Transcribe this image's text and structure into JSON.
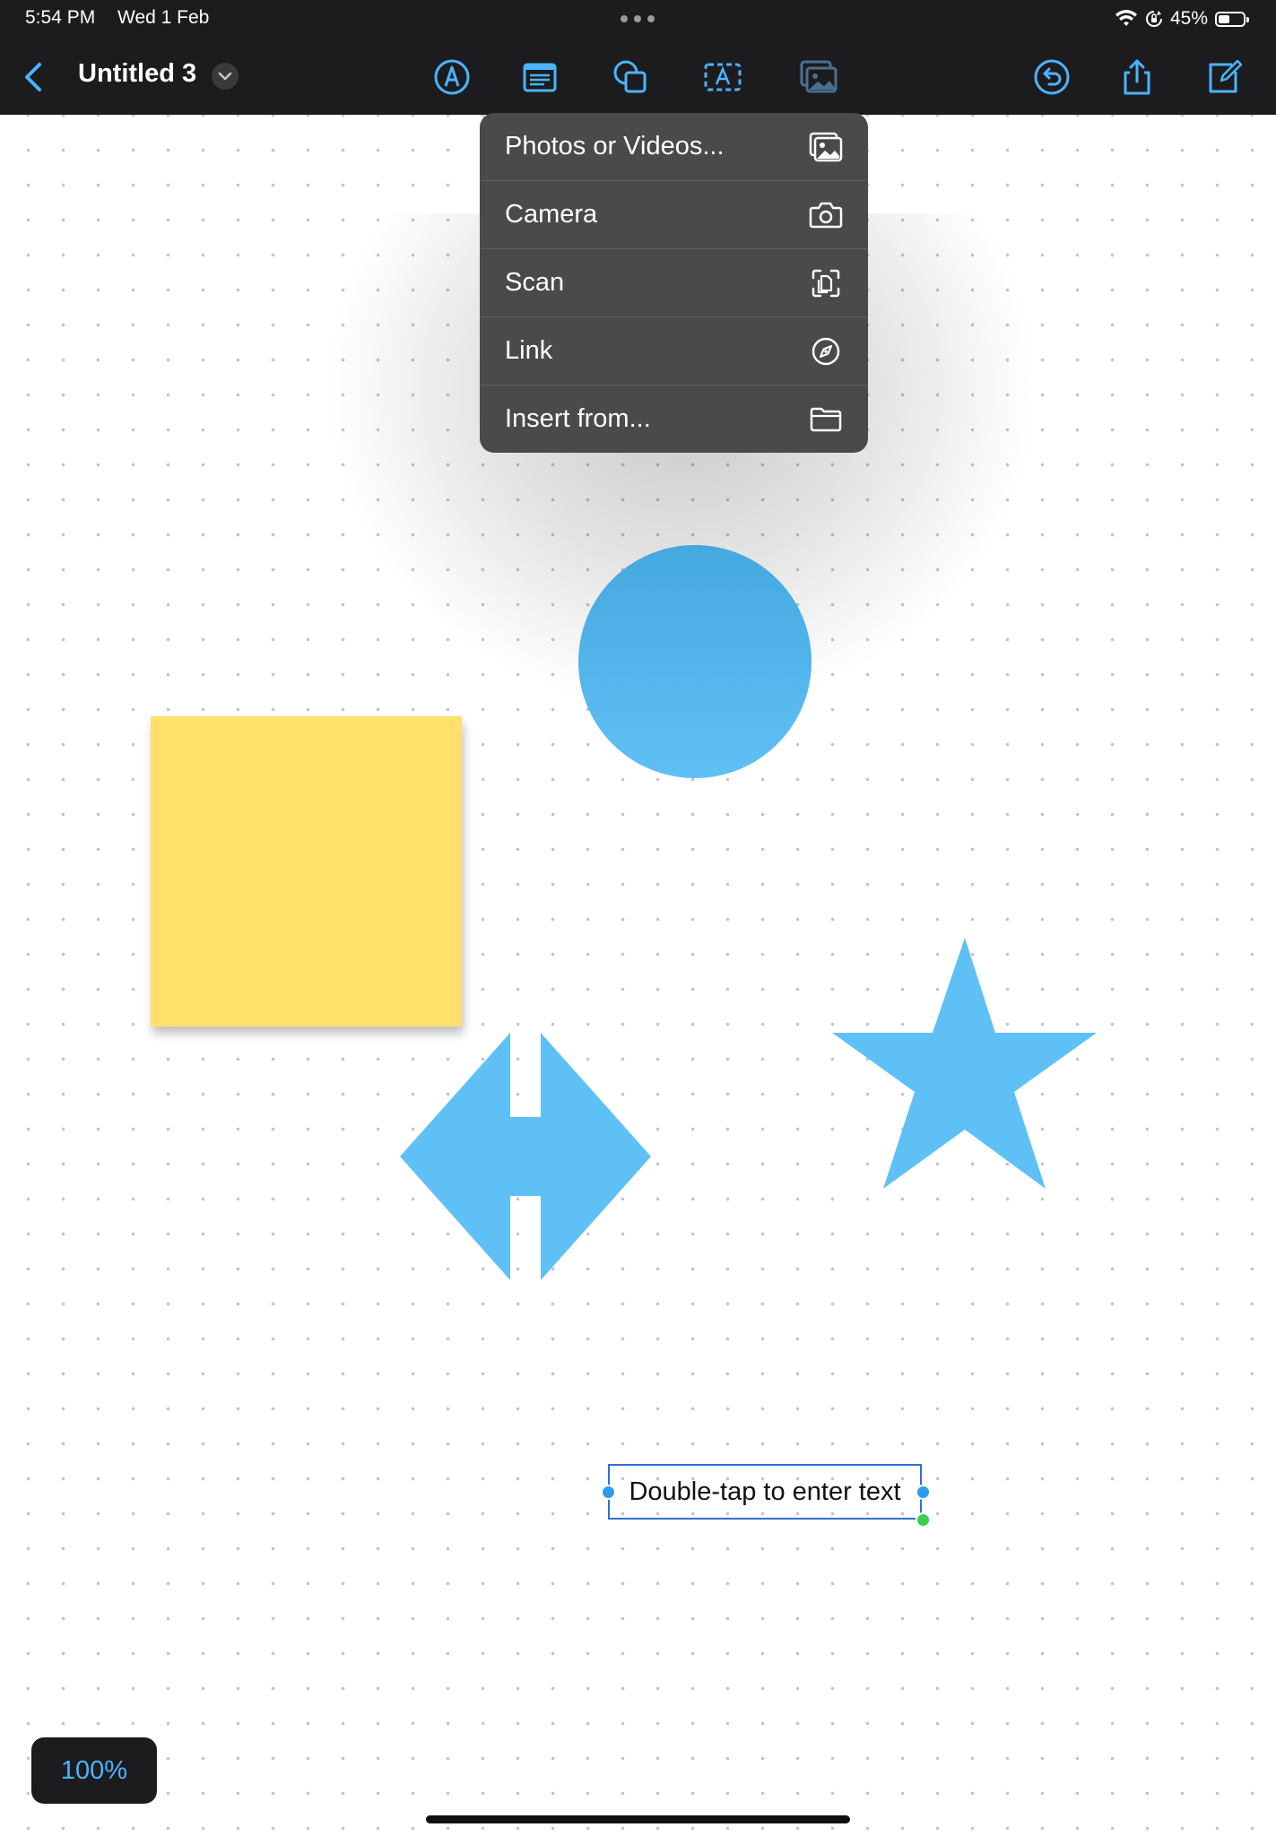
{
  "status_bar": {
    "time": "5:54 PM",
    "date": "Wed 1 Feb",
    "battery_text": "45%",
    "battery_level": 0.45
  },
  "toolbar": {
    "title": "Untitled 3",
    "icons": [
      "back-chevron-icon",
      "pen-tool-icon",
      "note-icon",
      "shapes-icon",
      "text-box-icon",
      "media-icon",
      "undo-icon",
      "share-icon",
      "compose-icon"
    ]
  },
  "insert_menu": {
    "items": [
      {
        "label": "Photos or Videos...",
        "icon": "photos-icon"
      },
      {
        "label": "Camera",
        "icon": "camera-icon"
      },
      {
        "label": "Scan",
        "icon": "scan-icon"
      },
      {
        "label": "Link",
        "icon": "compass-icon"
      },
      {
        "label": "Insert from...",
        "icon": "folder-icon"
      }
    ]
  },
  "canvas": {
    "text_box": "Double-tap to enter text",
    "zoom": "100%",
    "colors": {
      "sticky_note": "#ffe06b",
      "shape_blue": "#5fc0f5",
      "accent": "#4db3ff"
    }
  }
}
